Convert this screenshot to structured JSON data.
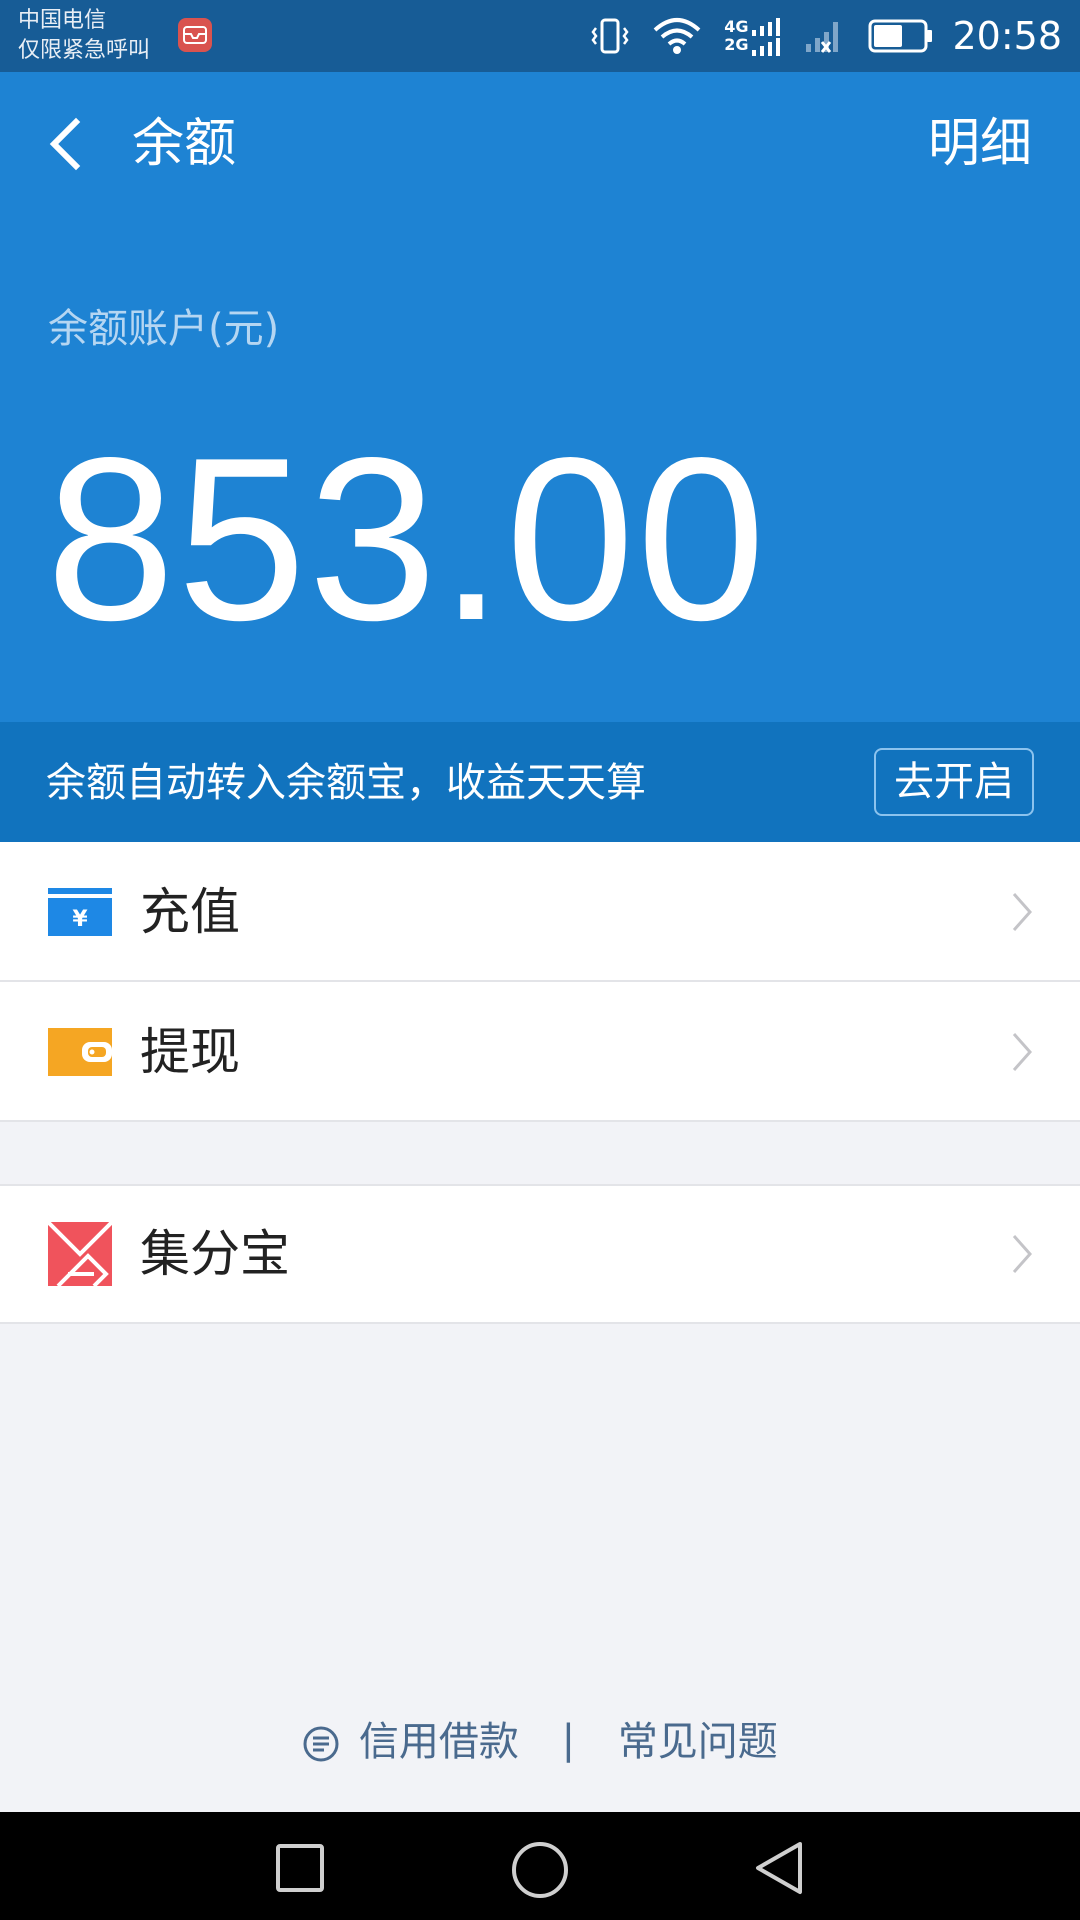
{
  "status_bar": {
    "carrier_line1": "中国电信",
    "carrier_line2": "仅限紧急呼叫",
    "network_top": "4G",
    "network_bottom": "2G",
    "time": "20:58"
  },
  "header": {
    "title": "余额",
    "detail_label": "明细",
    "account_label": "余额账户(元)",
    "amount": "853.00",
    "background_color": "#1e83d3"
  },
  "promo": {
    "text": "余额自动转入余额宝，收益天天算",
    "button_label": "去开启"
  },
  "menu": {
    "items": [
      {
        "label": "充值",
        "icon": "recharge-icon",
        "color": "#1e88e5"
      },
      {
        "label": "提现",
        "icon": "withdraw-icon",
        "color": "#f5a623"
      },
      {
        "label": "集分宝",
        "icon": "jifenbao-icon",
        "color": "#f0535c"
      }
    ]
  },
  "footer": {
    "credit_label": "信用借款",
    "separator": "|",
    "faq_label": "常见问题"
  },
  "nav": {
    "icons": [
      "recent-apps-icon",
      "home-icon",
      "back-icon"
    ]
  }
}
